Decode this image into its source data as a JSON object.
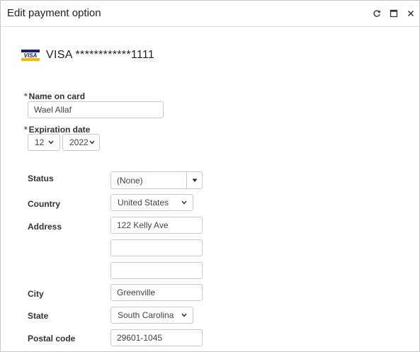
{
  "window": {
    "title": "Edit payment option",
    "controls": [
      "refresh-icon",
      "maximize-icon",
      "close-icon"
    ]
  },
  "card": {
    "brand_logo_text": "VISA",
    "display": "VISA ************1111"
  },
  "name_on_card": {
    "label": "Name on card",
    "required_marker": "*",
    "value": "Wael Allaf"
  },
  "expiration": {
    "label": "Expiration date",
    "required_marker": "*",
    "month": "12",
    "year": "2022"
  },
  "fields": {
    "status": {
      "label": "Status",
      "value": "(None)"
    },
    "country": {
      "label": "Country",
      "value": "United States"
    },
    "address": {
      "label": "Address",
      "line1": "122 Kelly Ave",
      "line2": "",
      "line3": ""
    },
    "city": {
      "label": "City",
      "value": "Greenville"
    },
    "state": {
      "label": "State",
      "value": "South Carolina"
    },
    "postal_code": {
      "label": "Postal code",
      "value": "29601-1045"
    }
  },
  "colors": {
    "required_star": "#c23934",
    "visa_blue": "#1a1f71",
    "visa_gold": "#f7b600",
    "border": "#c9c9c9"
  }
}
